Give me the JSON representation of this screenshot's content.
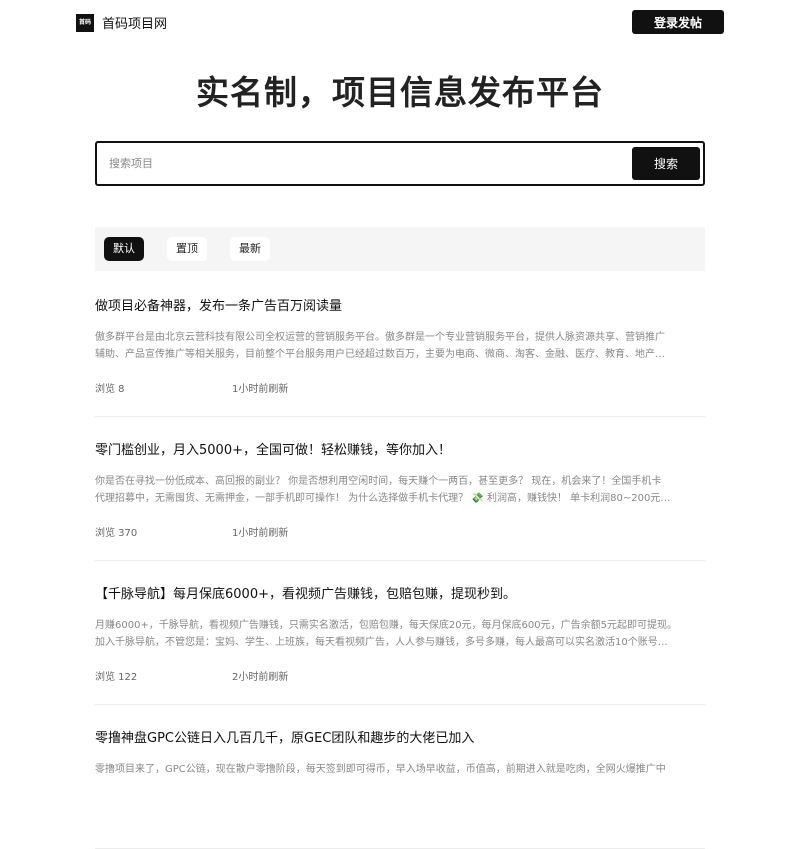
{
  "site": {
    "logo_mark": "首码",
    "logo_text": "首码项目网",
    "login_label": "登录发帖"
  },
  "hero": {
    "title": "实名制，项目信息发布平台"
  },
  "search": {
    "placeholder": "搜索项目",
    "button_label": "搜索"
  },
  "tabs": [
    {
      "label": "默认",
      "active": true
    },
    {
      "label": "置顶",
      "active": false
    },
    {
      "label": "最新",
      "active": false
    }
  ],
  "posts": [
    {
      "title": "做项目必备神器，发布一条广告百万阅读量",
      "desc_line1": "傲多群平台是由北京云营科技有限公司全权运营的营销服务平台。傲多群是一个专业营销服务平台，提供人脉资源共享、营销推广",
      "desc_line2": "辅助、产品宣传推广等相关服务，目前整个平台服务用户已经超过数百万，主要为电商、微商、淘客、金融、医疗、教育、地产…",
      "views": "浏览 8",
      "time": "1小时前刷新"
    },
    {
      "title": "零门槛创业，月入5000+，全国可做！轻松赚钱，等你加入！",
      "desc_line1": "你是否在寻找一份低成本、高回报的副业？ 你是否想利用空闲时间，每天赚个一两百，甚至更多？ 现在，机会来了！全国手机卡",
      "desc_line2": "代理招募中，无需囤货、无需押金，一部手机即可操作！ 为什么选择做手机卡代理？ 💸 利润高，赚钱快！ 单卡利润80~200元…",
      "views": "浏览 370",
      "time": "1小时前刷新"
    },
    {
      "title": "【千脉导航】每月保底6000+，看视频广告赚钱，包赔包赚，提现秒到。",
      "desc_line1": "月赚6000+，千脉导航，看视频广告赚钱，只需实名激活，包赔包赚，每天保底20元，每月保底600元，广告余额5元起即可提现。",
      "desc_line2": "加入千脉导航，不管您是：宝妈、学生、上班族，每天看视频广告，人人参与赚钱，多号多赚，每人最高可以实名激活10个账号…",
      "views": "浏览 122",
      "time": "2小时前刷新"
    },
    {
      "title": "零撸神盘GPC公链日入几百几千，原GEC团队和趣步的大佬已加入",
      "desc_line1": "零撸项目来了，GPC公链，现在散户零撸阶段，每天签到即可得币，早入场早收益，币值高，前期进入就是吃肉，全网火爆推广中",
      "desc_line2": "",
      "views": "",
      "time": ""
    }
  ]
}
